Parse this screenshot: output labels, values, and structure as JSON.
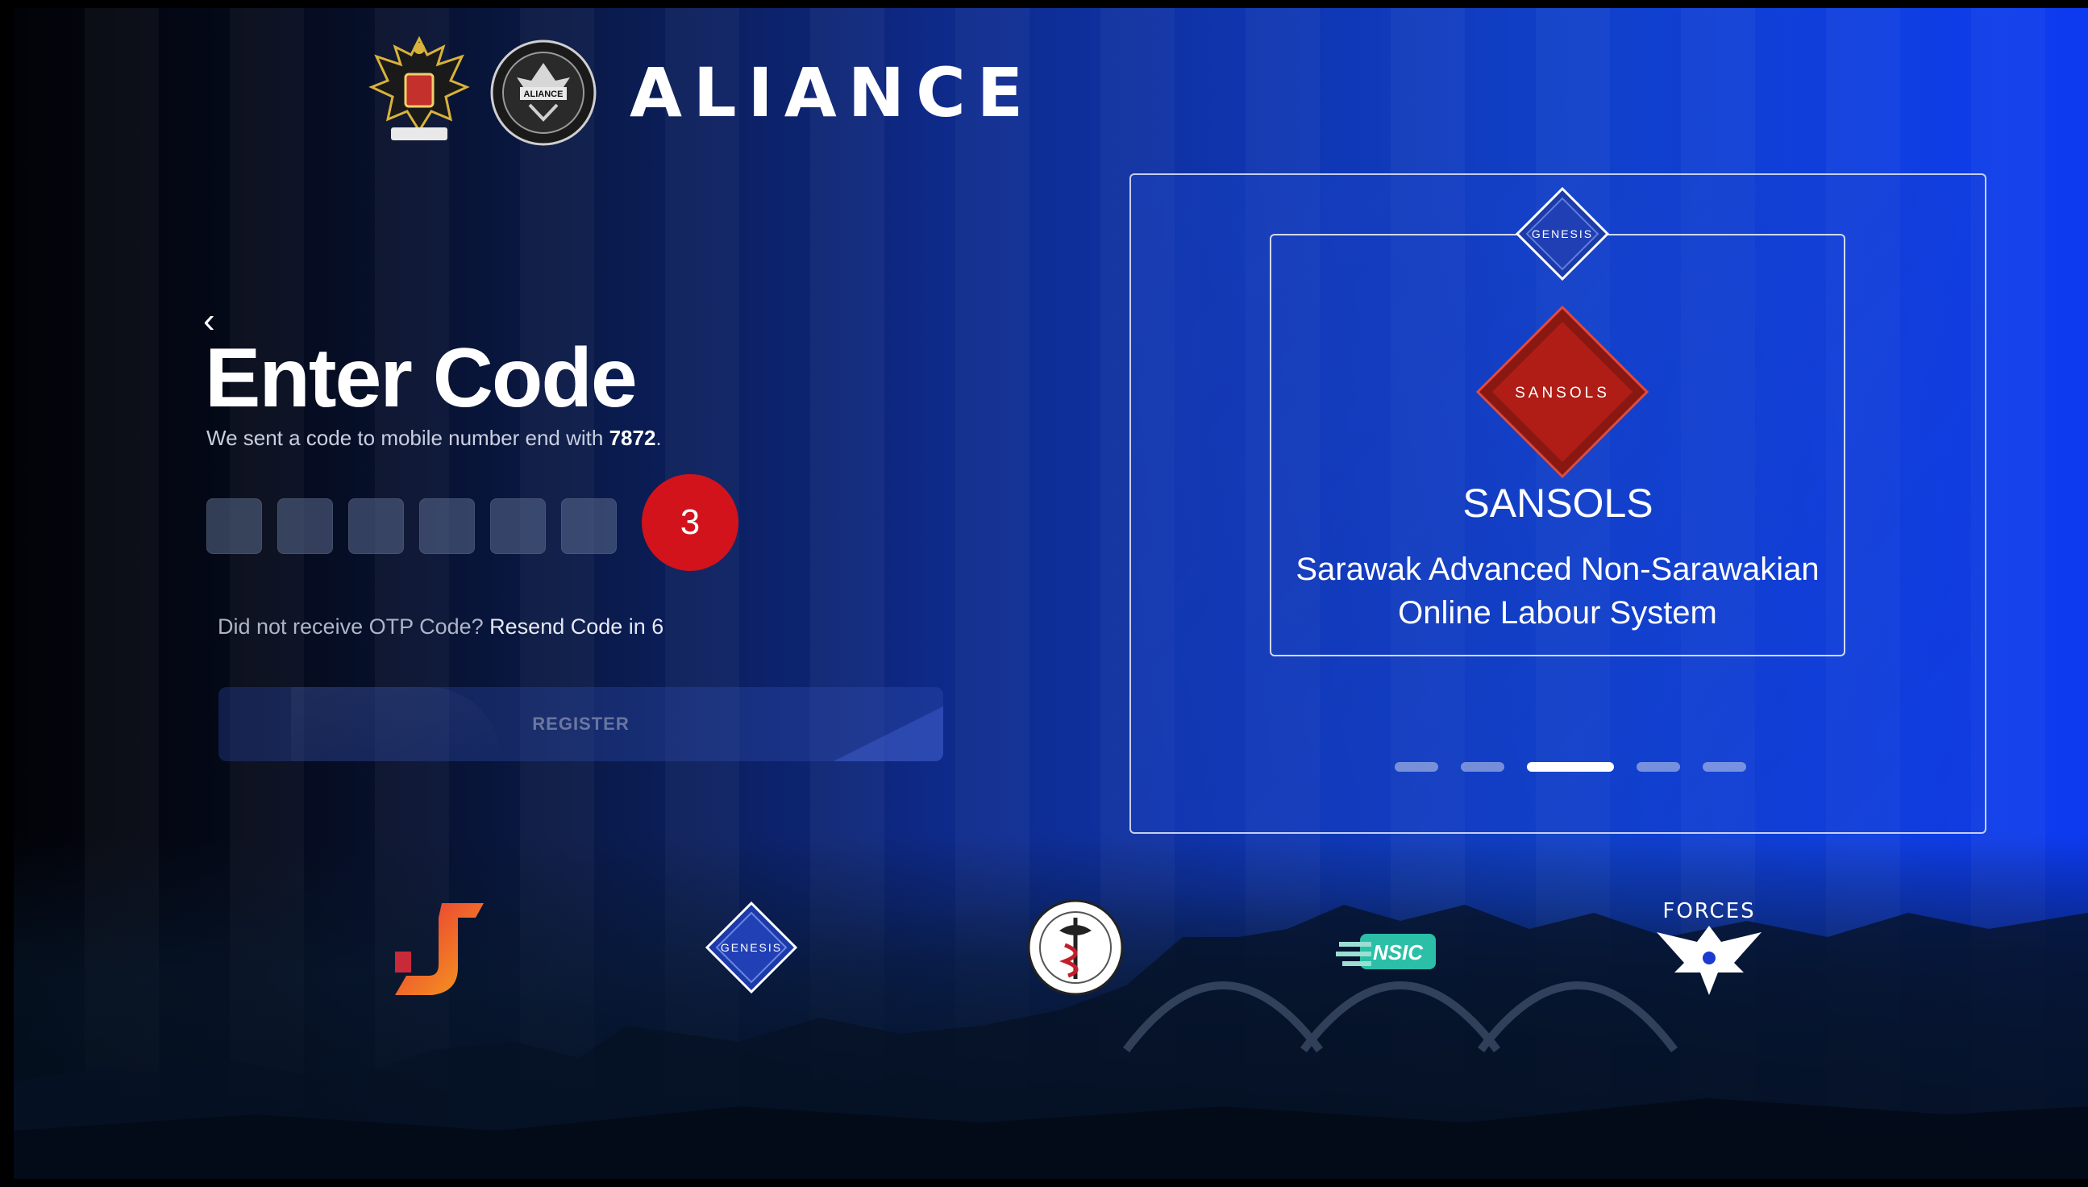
{
  "header": {
    "brand_name": "ALIANCE",
    "seal_text": "ALIANCE",
    "logos": [
      "crest-logo",
      "aliance-seal-logo"
    ]
  },
  "form": {
    "title": "Enter Code",
    "subtitle_prefix": "We sent a code to mobile number end with ",
    "phone_suffix": "7872",
    "subtitle_suffix": ".",
    "code_boxes": [
      "",
      "",
      "",
      "",
      "",
      ""
    ],
    "resend_prompt": "Did not receive OTP Code? ",
    "resend_link": "Resend Code in 6",
    "register_label": "REGISTER"
  },
  "badge": {
    "label": "3",
    "color": "#d2131b"
  },
  "carousel": {
    "top_logo_text": "GENESIS",
    "diamond_text": "SANSOLS",
    "slide_title": "SANSOLS",
    "slide_desc_line1": "Sarawak Advanced Non-Sarawakian",
    "slide_desc_line2": "Online Labour System",
    "dots_count": 5,
    "active_dot": 3
  },
  "footer": {
    "logos": [
      "j-logo",
      "genesis-logo",
      "health-seal-logo",
      "nsic-logo",
      "forces-logo"
    ],
    "genesis_text": "GENESIS",
    "nsic_text": "NSIC",
    "forces_text": "FORCES"
  },
  "colors": {
    "accent_red": "#d2131b",
    "sansols_red": "#b01c16",
    "genesis_blue": "#1c3aa8"
  }
}
